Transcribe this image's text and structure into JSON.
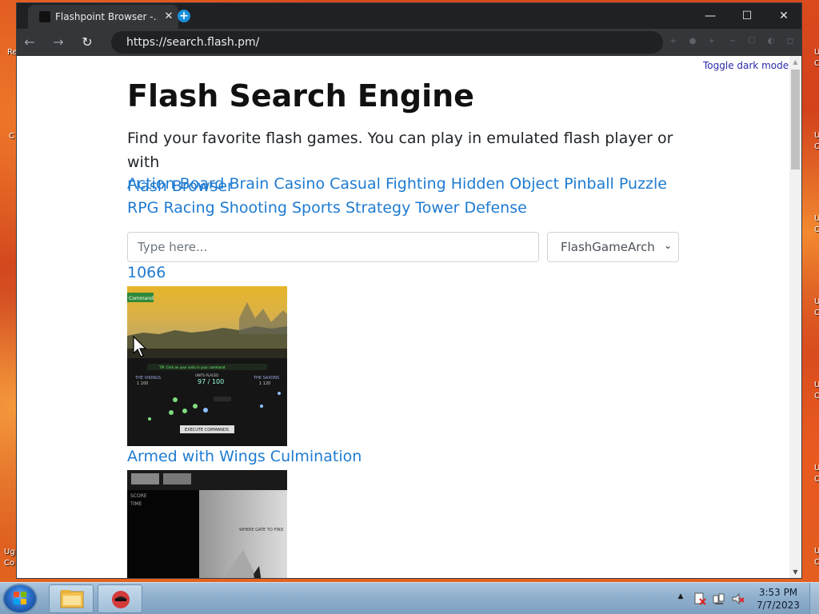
{
  "browser": {
    "tab_title": "Flashpoint Browser -...",
    "tab_close": "✕",
    "new_tab": "+",
    "url": "https://search.flash.pm/",
    "window_controls": {
      "minimize": "—",
      "maximize": "☐",
      "close": "✕"
    },
    "nav": {
      "back": "←",
      "forward": "→",
      "refresh": "↻"
    },
    "toolbar_icons": [
      "+",
      "●",
      "+",
      "−",
      "☐",
      "◐",
      "◻"
    ]
  },
  "page": {
    "toggle_dark": "Toggle dark mode",
    "title": "Flash Search Engine",
    "intro_text": "Find your favorite flash games. You can play in emulated flash player or with",
    "intro_link": "Flash Browser",
    "categories": [
      "Action",
      "Board",
      "Brain",
      "Casino",
      "Casual",
      "Fighting",
      "Hidden Object",
      "Pinball",
      "Puzzle",
      "RPG",
      "Racing",
      "Shooting",
      "Sports",
      "Strategy",
      "Tower Defense"
    ],
    "search": {
      "placeholder": "Type here...",
      "value": ""
    },
    "source_select": "FlashGameArchive",
    "results": [
      {
        "title": "1066",
        "thumb_texts": [
          "Command",
          "TIP: Click on your units in your command",
          "THE VIKINGS",
          "1 100",
          "UNITS PLACED",
          "97 / 100",
          "THE SAXONS",
          "1 120",
          "EXECUTE COMMANDS"
        ]
      },
      {
        "title": "Armed with Wings Culmination",
        "thumb_texts": [
          "SCORE",
          "TIME",
          "WHERE GATE TO FIND"
        ]
      }
    ]
  },
  "taskbar": {
    "clock_time": "3:53 PM",
    "clock_date": "7/7/2023",
    "tray_expand": "▲",
    "app_buttons": [
      "file-explorer",
      "flashpoint"
    ]
  },
  "desktop": {
    "icon_labels_left": [
      "Re",
      "C",
      "Ug",
      "Co"
    ],
    "icon_labels_right": [
      "U",
      "C",
      "U",
      "C",
      "U",
      "C",
      "U",
      "C",
      "U",
      "C",
      "U",
      "C",
      "U",
      "C"
    ]
  }
}
